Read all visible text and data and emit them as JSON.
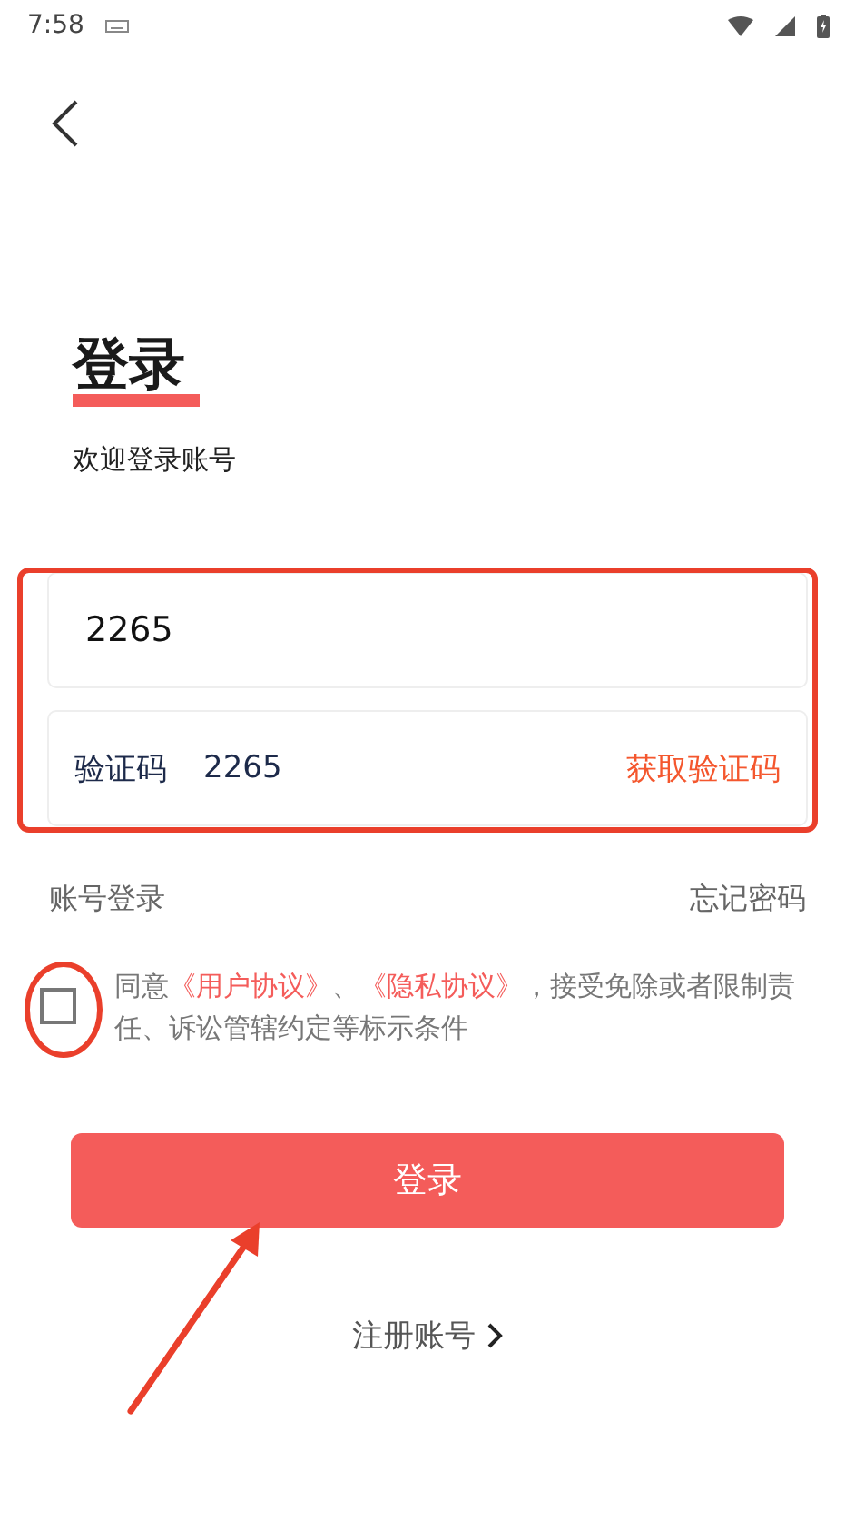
{
  "status_bar": {
    "time": "7:58"
  },
  "header": {
    "title": "登录",
    "subtitle": "欢迎登录账号"
  },
  "phone_field": {
    "value": "2265"
  },
  "code_field": {
    "label": "验证码",
    "value": "2265",
    "action": "获取验证码"
  },
  "links": {
    "left": "账号登录",
    "right": "忘记密码"
  },
  "agreement": {
    "checked": false,
    "parts": [
      {
        "kind": "text",
        "text": "同意"
      },
      {
        "kind": "link",
        "text": "《用户协议》"
      },
      {
        "kind": "text",
        "text": "、"
      },
      {
        "kind": "link",
        "text": "《隐私协议》"
      },
      {
        "kind": "text",
        "text": "，接受免除或者限制责任、诉讼管辖约定等标示条件"
      }
    ]
  },
  "login_button": {
    "label": "登录"
  },
  "register_link": {
    "label": "注册账号"
  },
  "annotations": [
    {
      "kind": "box"
    },
    {
      "kind": "circle"
    },
    {
      "kind": "arrow"
    }
  ]
}
